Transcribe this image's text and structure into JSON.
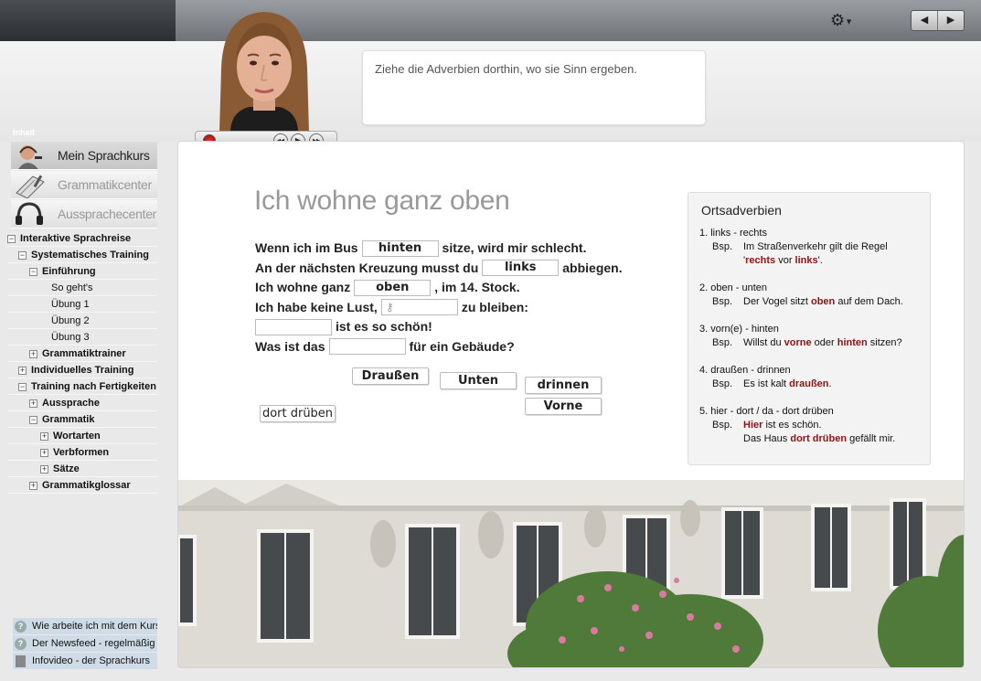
{
  "topbar": {
    "settings_icon": "gear-icon",
    "prev_icon": "◀",
    "next_icon": "▶"
  },
  "player": {
    "rew": "◂◂",
    "play": "▶",
    "ff": "▸▸"
  },
  "bubble": {
    "text": "Ziehe die Adverbien dorthin, wo sie Sinn ergeben."
  },
  "sidebar": {
    "heading": "Inhalt",
    "tiles": [
      {
        "label": "Mein Sprachkurs",
        "icon": "person-headset-icon"
      },
      {
        "label": "Grammatikcenter",
        "icon": "notebook-icon"
      },
      {
        "label": "Aussprachecenter",
        "icon": "headphones-icon"
      }
    ],
    "tree": [
      {
        "label": "Interaktive Sprachreise",
        "box": "−",
        "level": 0,
        "bold": true
      },
      {
        "label": "Systematisches Training",
        "box": "−",
        "level": 1,
        "bold": true
      },
      {
        "label": "Einführung",
        "box": "−",
        "level": 2,
        "bold": true
      },
      {
        "label": "So geht's",
        "box": "",
        "level": 4,
        "bold": false
      },
      {
        "label": "Übung 1",
        "box": "",
        "level": 4,
        "bold": false
      },
      {
        "label": "Übung 2",
        "box": "",
        "level": 4,
        "bold": false
      },
      {
        "label": "Übung 3",
        "box": "",
        "level": 4,
        "bold": false
      },
      {
        "label": "Grammatiktrainer",
        "box": "+",
        "level": 2,
        "bold": true
      },
      {
        "label": "Individuelles Training",
        "box": "+",
        "level": 1,
        "bold": true
      },
      {
        "label": "Training nach Fertigkeiten",
        "box": "−",
        "level": 1,
        "bold": true
      },
      {
        "label": "Aussprache",
        "box": "+",
        "level": 2,
        "bold": true
      },
      {
        "label": "Grammatik",
        "box": "−",
        "level": 2,
        "bold": true
      },
      {
        "label": "Wortarten",
        "box": "+",
        "level": 3,
        "bold": true
      },
      {
        "label": "Verbformen",
        "box": "+",
        "level": 3,
        "bold": true
      },
      {
        "label": "Sätze",
        "box": "+",
        "level": 3,
        "bold": true
      },
      {
        "label": "Grammatikglossar",
        "box": "+",
        "level": 2,
        "bold": true
      }
    ],
    "help": [
      {
        "label": "Wie arbeite ich mit dem Kurs?",
        "icon": "help-icon"
      },
      {
        "label": "Der Newsfeed - regelmäßig",
        "icon": "help-icon"
      },
      {
        "label": "Infovideo - der Sprachkurs",
        "icon": "film-icon"
      }
    ]
  },
  "exercise": {
    "title": "Ich wohne ganz oben",
    "lines": [
      {
        "before": "Wenn ich im Bus",
        "slot": "hinten",
        "after": "sitze, wird mir schlecht."
      },
      {
        "before": "An der nächsten Kreuzung musst du",
        "slot": "links",
        "after": "abbiegen."
      },
      {
        "before": "Ich wohne ganz",
        "slot": "oben",
        "after": ", im 14. Stock."
      },
      {
        "before": "Ich habe keine Lust,",
        "slot": "",
        "after": "zu bleiben:"
      },
      {
        "before": "",
        "slot": "",
        "after": "ist es so schön!"
      },
      {
        "before": "Was ist das",
        "slot": "",
        "after": "für ein Gebäude?"
      }
    ],
    "chips": [
      "Draußen",
      "Unten",
      "drinnen",
      "Vorne",
      "dort drüben"
    ]
  },
  "info": {
    "title": "Ortsadverbien",
    "bsp": "Bsp.",
    "entries": [
      {
        "head": "1. links - rechts",
        "ex1": "Im Straßenverkehr gilt die Regel",
        "ex2a": "'",
        "ex2hl1": "rechts",
        "ex2b": " vor ",
        "ex2hl2": "links",
        "ex2c": "'."
      },
      {
        "head": "2. oben - unten",
        "ex_a": "Der Vogel sitzt ",
        "ex_hl": "oben",
        "ex_b": " auf dem Dach."
      },
      {
        "head": "3. vorn(e) - hinten",
        "ex_a": "Willst du ",
        "ex_hl": "vorne",
        "ex_b": " oder ",
        "ex_hl2": "hinten",
        "ex_c": " sitzen?"
      },
      {
        "head": "4. draußen - drinnen",
        "ex_a": "Es ist kalt ",
        "ex_hl": "draußen",
        "ex_b": "."
      },
      {
        "head": "5. hier - dort / da - dort drüben",
        "ex_hl": "Hier",
        "ex_a": " ist es schön.",
        "ex2_a": "Das Haus ",
        "ex2_hl": "dort drüben",
        "ex2_b": " gefällt mir."
      }
    ]
  },
  "colors": {
    "highlight": "#8b1414",
    "sidebar_help_bg": "#cfdbe6"
  }
}
